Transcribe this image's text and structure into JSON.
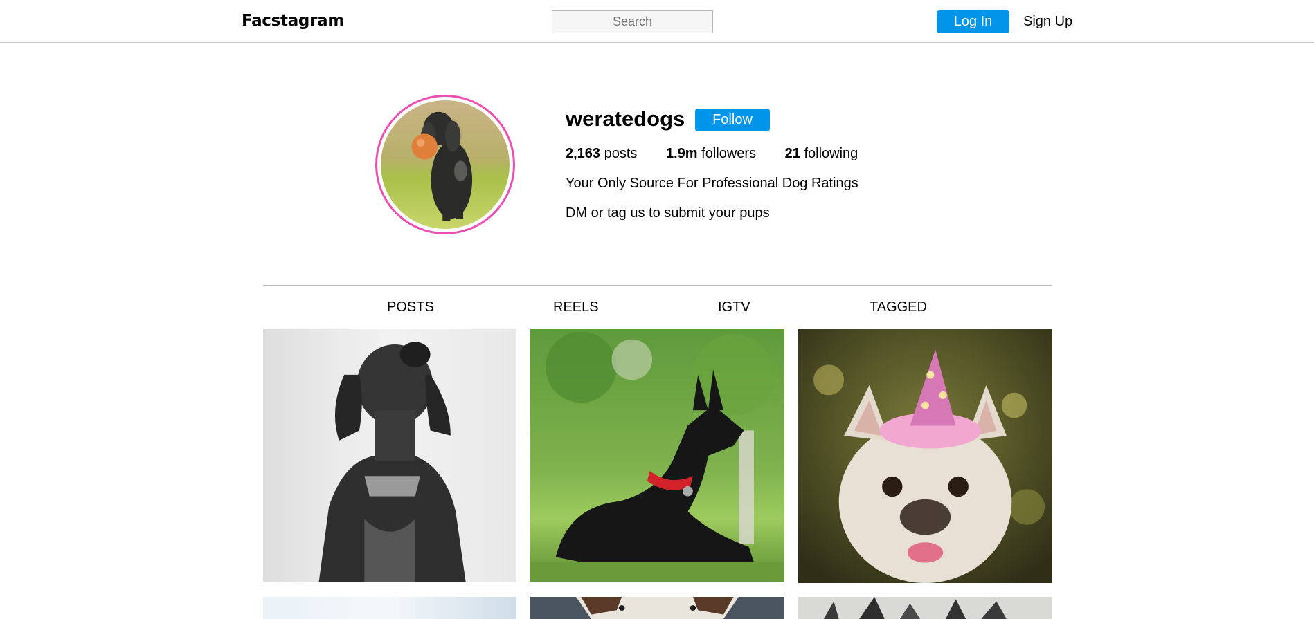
{
  "header": {
    "logo": "Facstagram",
    "search_placeholder": "Search",
    "login_label": "Log In",
    "signup_label": "Sign Up",
    "accent_color": "#0095e8"
  },
  "profile": {
    "username": "weratedogs",
    "follow_label": "Follow",
    "stats": {
      "posts_count": "2,163",
      "posts_label": "posts",
      "followers_count": "1.9m",
      "followers_label": "followers",
      "following_count": "21",
      "following_label": "following"
    },
    "bio_lines": [
      "Your Only Source For Professional Dog Ratings",
      "DM or tag us to submit your pups"
    ],
    "avatar_ring_color": "#ea4fb1"
  },
  "tabs": [
    "POSTS",
    "REELS",
    "IGTV",
    "TAGGED"
  ],
  "grid": {
    "posts": [
      {
        "subject": "black-white-dog-photo"
      },
      {
        "subject": "black-dog-red-collar-photo"
      },
      {
        "subject": "french-bulldog-party-hat-photo"
      },
      {
        "subject": "dog-photo-sky"
      },
      {
        "subject": "dog-photo-brown-white"
      },
      {
        "subject": "dog-photo-trees"
      }
    ]
  }
}
